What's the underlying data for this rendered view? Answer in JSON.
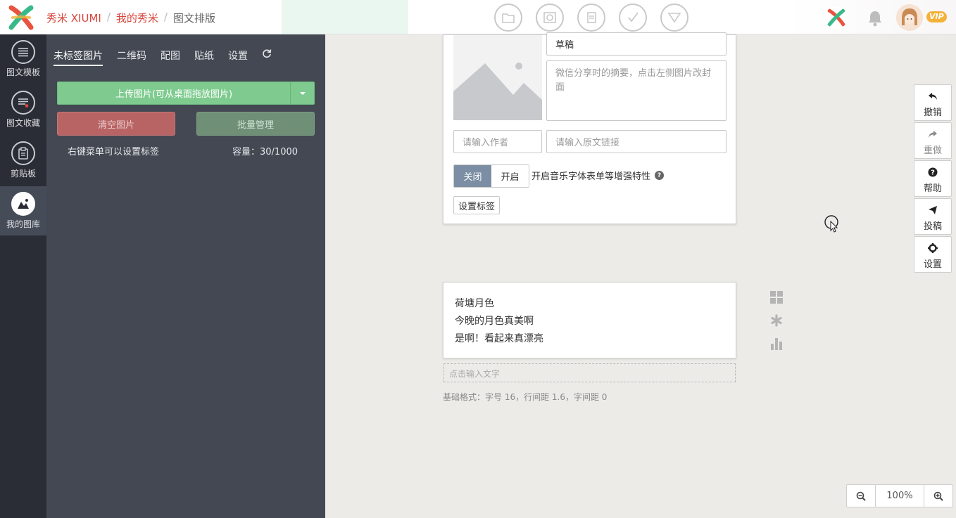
{
  "header": {
    "brand": "秀米 XIUMI",
    "breadcrumb_mine": "我的秀米",
    "breadcrumb_current": "图文排版",
    "separator": "/",
    "vip": "VIP",
    "tool_icons": [
      "folder-icon",
      "image-stack-icon",
      "copy-icon",
      "check-icon",
      "triangle-down-icon"
    ]
  },
  "leftnav": {
    "items": [
      {
        "label": "图文模板",
        "icon": "list-icon"
      },
      {
        "label": "图文收藏",
        "icon": "favorite-list-icon"
      },
      {
        "label": "剪贴板",
        "icon": "clipboard-icon"
      },
      {
        "label": "我的图库",
        "icon": "gallery-icon"
      }
    ]
  },
  "panel": {
    "tabs": [
      "未标签图片",
      "二维码",
      "配图",
      "贴纸",
      "设置"
    ],
    "upload_label": "上传图片(可从桌面拖放图片)",
    "clear_label": "清空图片",
    "batch_label": "批量管理",
    "hint": "右键菜单可以设置标签",
    "capacity": "容量：30/1000"
  },
  "editor": {
    "title_value": "草稿",
    "summary_placeholder": "微信分享时的摘要，点击左侧图片改封面",
    "author_placeholder": "请输入作者",
    "link_placeholder": "请输入原文链接",
    "toggle_off": "关闭",
    "toggle_on": "开启",
    "enhance_text": "开启音乐字体表单等增强特性",
    "tag_button": "设置标签"
  },
  "content": {
    "lines": [
      "荷塘月色",
      "今晚的月色真美啊",
      "是啊！看起来真漂亮"
    ],
    "input_placeholder": "点击输入文字",
    "base_format": "基础格式：字号 16，行间距 1.6，字间距 0"
  },
  "right_tools": {
    "undo": "撤销",
    "redo": "重做",
    "help": "帮助",
    "submit": "投稿",
    "settings": "设置"
  },
  "zoom": {
    "value": "100%"
  }
}
